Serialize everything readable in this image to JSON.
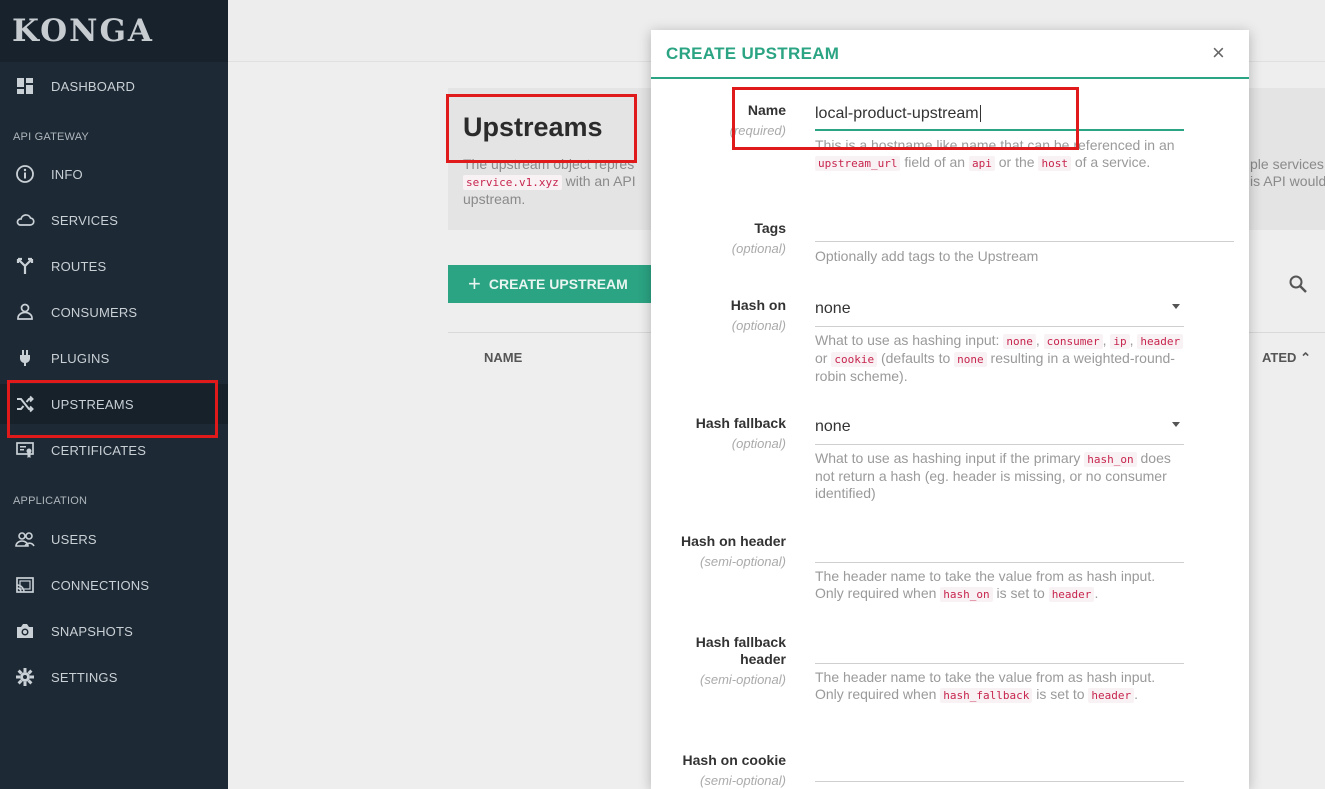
{
  "app": {
    "logo": "KONGA"
  },
  "sidebar": {
    "items": [
      {
        "label": "DASHBOARD",
        "icon": "dashboard-icon"
      },
      {
        "label": "INFO",
        "icon": "info-icon"
      },
      {
        "label": "SERVICES",
        "icon": "cloud-icon"
      },
      {
        "label": "ROUTES",
        "icon": "routes-icon"
      },
      {
        "label": "CONSUMERS",
        "icon": "user-icon"
      },
      {
        "label": "PLUGINS",
        "icon": "plug-icon"
      },
      {
        "label": "UPSTREAMS",
        "icon": "shuffle-icon"
      },
      {
        "label": "CERTIFICATES",
        "icon": "certificate-icon"
      },
      {
        "label": "USERS",
        "icon": "users-icon"
      },
      {
        "label": "CONNECTIONS",
        "icon": "cast-icon"
      },
      {
        "label": "SNAPSHOTS",
        "icon": "camera-icon"
      },
      {
        "label": "SETTINGS",
        "icon": "gear-icon"
      }
    ],
    "sections": {
      "api_gateway": "API GATEWAY",
      "application": "APPLICATION"
    }
  },
  "main": {
    "title": "Upstreams",
    "intro_line1": "The upstream object repres",
    "intro_code": "service.v1.xyz",
    "intro_line2": "with an API",
    "intro_line3": "upstream.",
    "intro_right1": "ple services",
    "intro_right2": "is API would",
    "create_button": "CREATE UPSTREAM",
    "columns": {
      "name": "NAME",
      "created": "ATED"
    }
  },
  "modal": {
    "title": "CREATE UPSTREAM",
    "close": "×",
    "fields": {
      "name": {
        "label": "Name",
        "sub": "(required)",
        "value": "local-product-upstream",
        "help_pre": "This is a hostname like name that can be referenced in an",
        "code1": "upstream_url",
        "help_mid1": "field of an",
        "code2": "api",
        "help_mid2": "or the",
        "code3": "host",
        "help_post": "of a service."
      },
      "tags": {
        "label": "Tags",
        "sub": "(optional)",
        "help": "Optionally add tags to the Upstream"
      },
      "hash_on": {
        "label": "Hash on",
        "sub": "(optional)",
        "value": "none",
        "help_pre": "What to use as hashing input:",
        "c1": "none",
        "c2": "consumer",
        "c3": "ip",
        "c4": "header",
        "or": "or",
        "c5": "cookie",
        "help_mid": "(defaults to",
        "c6": "none",
        "help_post": "resulting in a weighted-round-robin scheme)."
      },
      "hash_fallback": {
        "label": "Hash fallback",
        "sub": "(optional)",
        "value": "none",
        "help_pre": "What to use as hashing input if the primary",
        "code": "hash_on",
        "help_post": "does not return a hash (eg. header is missing, or no consumer identified)"
      },
      "hash_on_header": {
        "label": "Hash on header",
        "sub": "(semi-optional)",
        "help_pre": "The header name to take the value from as hash input. Only required when",
        "code1": "hash_on",
        "help_mid": "is set to",
        "code2": "header",
        "help_post": "."
      },
      "hash_fallback_header": {
        "label_line1": "Hash fallback",
        "label_line2": "header",
        "sub": "(semi-optional)",
        "help_pre": "The header name to take the value from as hash input. Only required when",
        "code1": "hash_fallback",
        "help_mid": "is set to",
        "code2": "header",
        "help_post": "."
      },
      "hash_on_cookie": {
        "label": "Hash on cookie",
        "sub": "(semi-optional)"
      }
    }
  },
  "colors": {
    "accent": "#2ba483",
    "sidebar_bg": "#1d2934",
    "highlight": "#e0191b"
  }
}
